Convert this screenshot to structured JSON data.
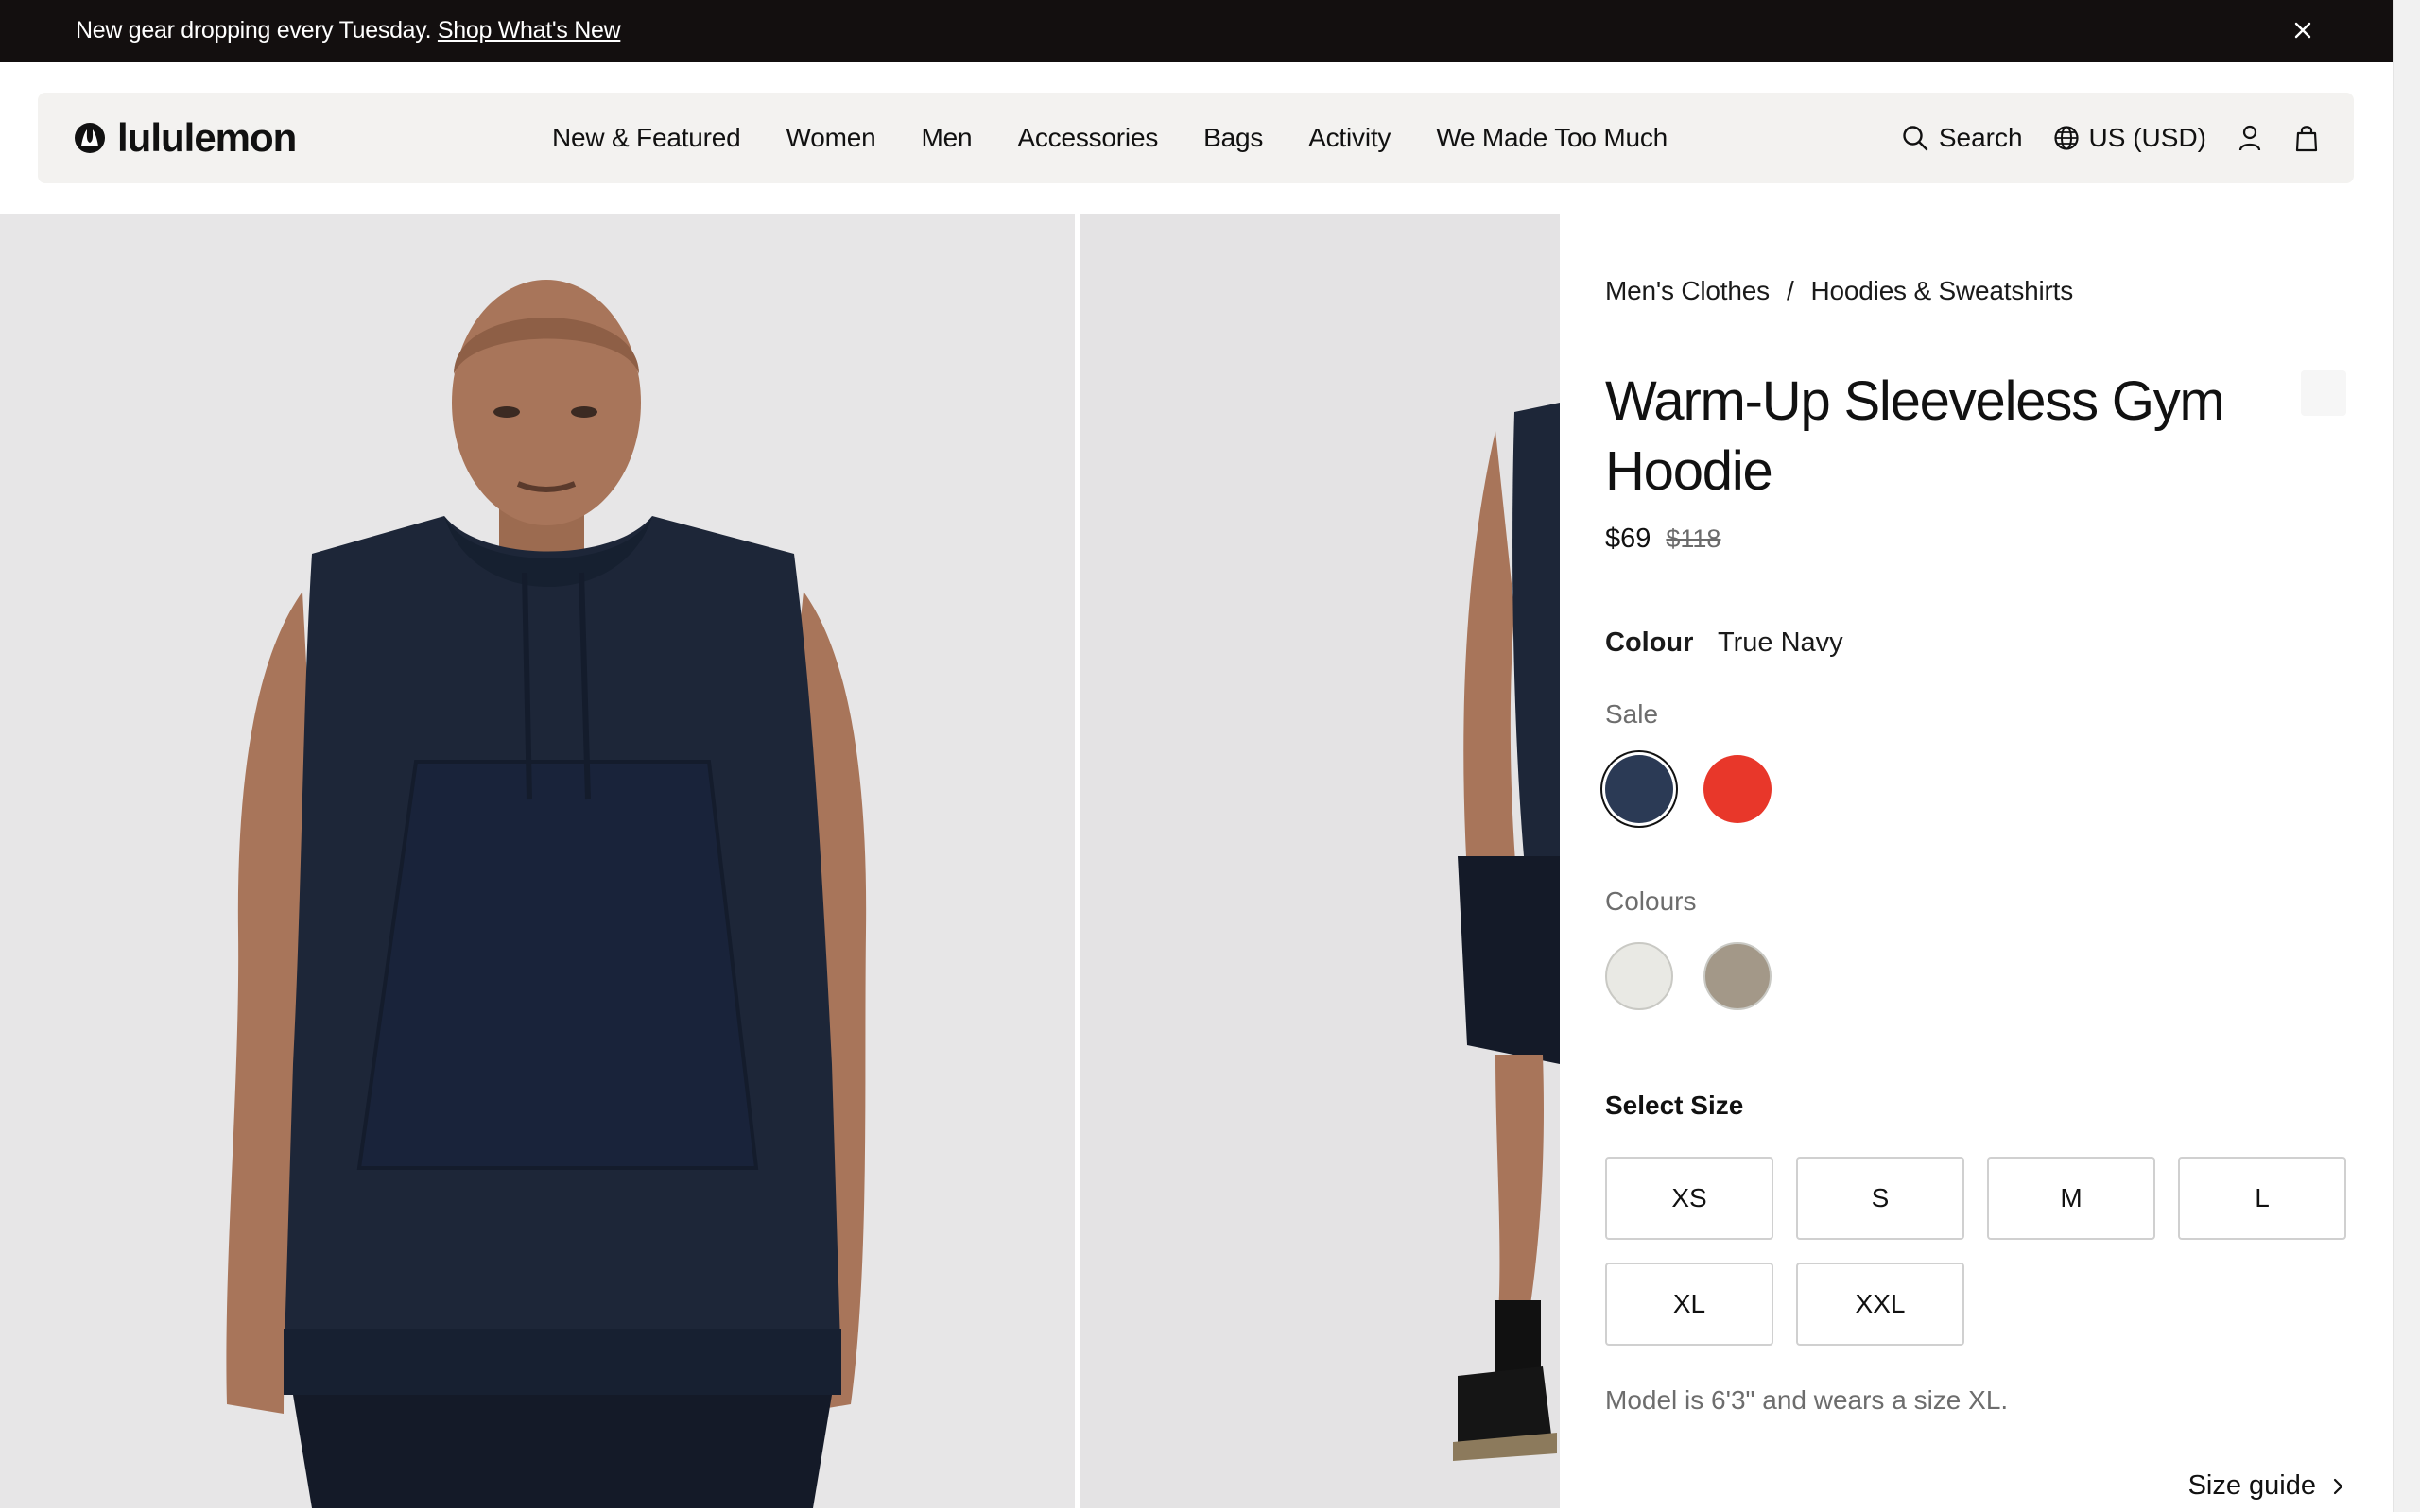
{
  "promo": {
    "text": "New gear dropping every Tuesday.",
    "link": "Shop What's New"
  },
  "header": {
    "brand": "lululemon",
    "nav": [
      "New & Featured",
      "Women",
      "Men",
      "Accessories",
      "Bags",
      "Activity",
      "We Made Too Much"
    ],
    "search_label": "Search",
    "region_label": "US (USD)"
  },
  "product": {
    "breadcrumb": [
      "Men's Clothes",
      "Hoodies & Sweatshirts"
    ],
    "breadcrumb_separator": "/",
    "title": "Warm-Up Sleeveless Gym Hoodie",
    "price_sale": "$69",
    "price_original": "$118",
    "colour_label": "Colour",
    "colour_value": "True Navy",
    "sale_label": "Sale",
    "sale_swatches": [
      {
        "color": "#2b3a55",
        "selected": true
      },
      {
        "color": "#e8372a",
        "selected": false
      }
    ],
    "colours_label": "Colours",
    "colour_swatches": [
      {
        "color": "#e9e9e4",
        "selected": false
      },
      {
        "color": "#a39888",
        "selected": false
      }
    ],
    "size_heading": "Select Size",
    "sizes": [
      "XS",
      "S",
      "M",
      "L",
      "XL",
      "XXL"
    ],
    "model_note": "Model is 6'3\" and wears a size XL.",
    "size_guide": "Size guide"
  }
}
